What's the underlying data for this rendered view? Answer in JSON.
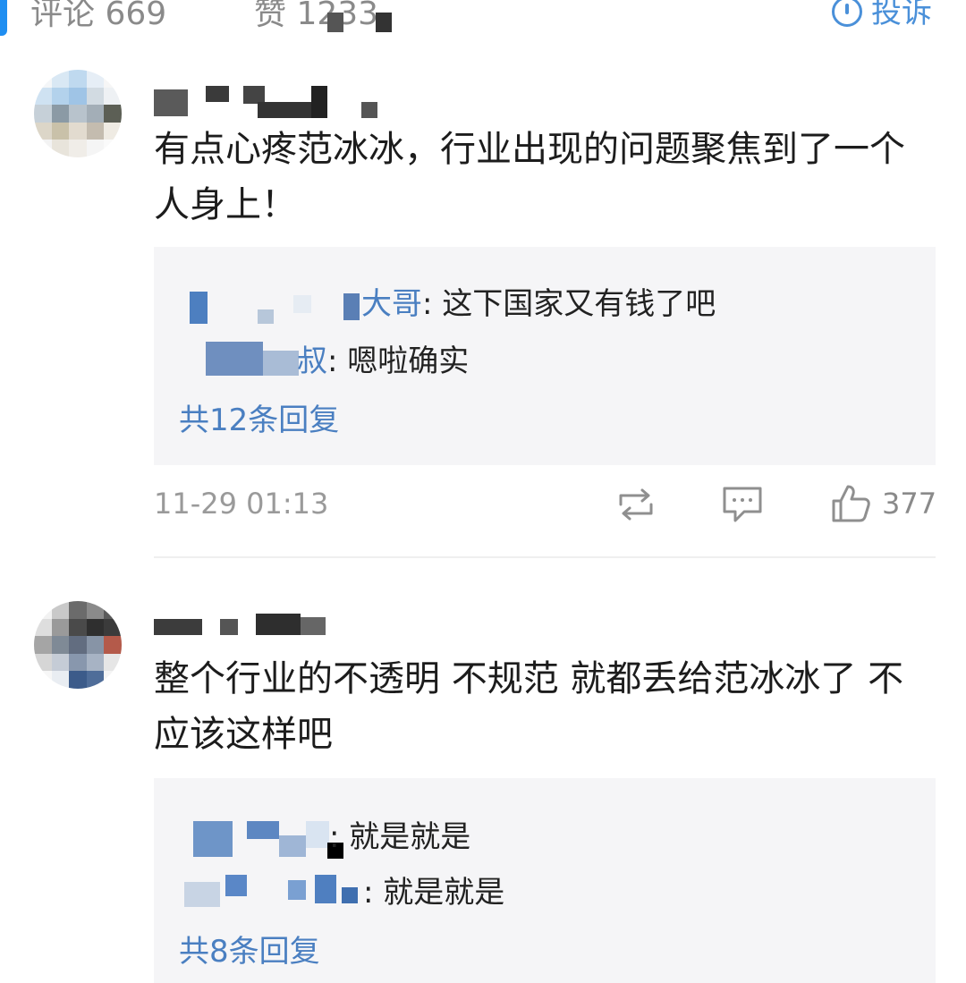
{
  "header": {
    "comments_label": "评论 669",
    "likes_label": "赞 1233",
    "report_label": "投诉"
  },
  "comments": [
    {
      "text": "有点心疼范冰冰，行业出现的问题聚焦到了一个人身上！",
      "replies": [
        {
          "name_tail": "大哥",
          "text": ": 这下国家又有钱了吧"
        },
        {
          "name_tail": "叔",
          "text": ": 嗯啦确实"
        }
      ],
      "reply_count": "共12条回复",
      "time": "11-29 01:13",
      "likes": "377"
    },
    {
      "text": "整个行业的不透明 不规范 就都丢给范冰冰了 不应该这样吧",
      "replies": [
        {
          "name_tail": "",
          "text": ": 就是就是"
        },
        {
          "name_tail": "",
          "text": ": 就是就是"
        }
      ],
      "reply_count": "共8条回复"
    }
  ],
  "icons": {
    "repost": "repost-icon",
    "comment": "comment-icon",
    "like": "thumbs-up-icon",
    "report": "report-icon"
  },
  "colors": {
    "link": "#4a7fc1",
    "accent": "#1f8ef1",
    "muted": "#9a9a9a",
    "reply_bg": "#f5f5f7"
  }
}
